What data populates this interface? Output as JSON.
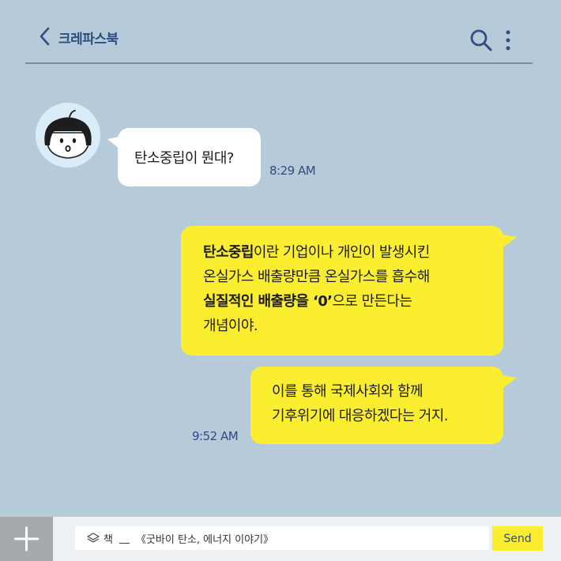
{
  "header": {
    "title": "크레파스북",
    "back_icon": "chevron-left-icon",
    "search_icon": "search-icon",
    "more_icon": "more-vertical-icon"
  },
  "messages": [
    {
      "sender": "other",
      "text": "탄소중립이 뭔대?",
      "time": "8:29 AM"
    },
    {
      "sender": "me",
      "segments": [
        {
          "text": "탄소중립",
          "bold": true
        },
        {
          "text": "이란 기업이나 개인이 발생시킨",
          "bold": false
        },
        {
          "text": "온실가스 배출량만큼 온실가스를 흡수해",
          "bold": false
        },
        {
          "text": "실질적인 배출량을 ‘0’",
          "bold": true
        },
        {
          "text": "으로 만든다는",
          "bold": false
        },
        {
          "text": "개념이야.",
          "bold": false
        }
      ]
    },
    {
      "sender": "me",
      "lines": [
        "이를 통해 국제사회와 함께",
        "기후위기에 대응하겠다는 거지."
      ],
      "time": "9:52 AM"
    }
  ],
  "input": {
    "book_icon": "book-stack-icon",
    "prefix": "책",
    "underscore": "__",
    "value": "《굿바이 탄소, 에너지 이야기》"
  },
  "send_label": "Send",
  "colors": {
    "background": "#b5cbd9",
    "accent": "#2f4d7e",
    "bubble_yellow": "#fbee31",
    "bubble_white": "#ffffff"
  }
}
